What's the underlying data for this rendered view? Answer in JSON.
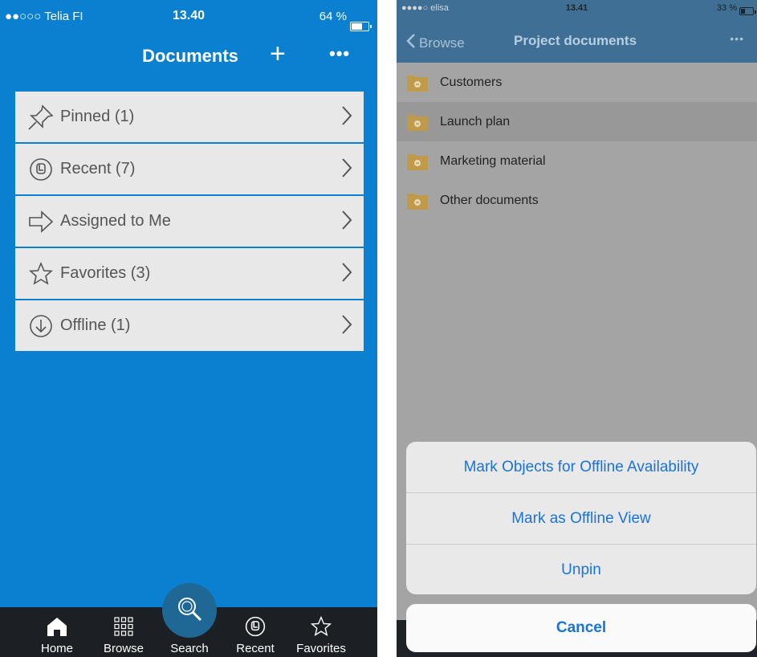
{
  "left": {
    "status": {
      "carrier": "●●○○○ Telia FI",
      "time": "13.40",
      "battery": "64 %",
      "battery_level": 0.64
    },
    "nav": {
      "title": "Documents",
      "add_label": "+",
      "more_label": "•••"
    },
    "menu": [
      {
        "label": "Pinned (1)",
        "icon": "pin-icon"
      },
      {
        "label": "Recent (7)",
        "icon": "clock-icon"
      },
      {
        "label": "Assigned to Me",
        "icon": "arrow-right-icon"
      },
      {
        "label": "Favorites (3)",
        "icon": "star-icon"
      },
      {
        "label": "Offline (1)",
        "icon": "download-icon"
      }
    ],
    "tabs": [
      {
        "label": "Home",
        "icon": "home-icon"
      },
      {
        "label": "Browse",
        "icon": "grid-icon"
      },
      {
        "label": "Search",
        "icon": "search-icon"
      },
      {
        "label": "Recent",
        "icon": "clock-icon"
      },
      {
        "label": "Favorites",
        "icon": "star-icon"
      }
    ]
  },
  "right": {
    "status": {
      "carrier": "●●●●○ elisa",
      "time": "13.41",
      "battery": "33 %",
      "battery_level": 0.33
    },
    "nav": {
      "back_label": "Browse",
      "title": "Project documents",
      "more_label": "•••"
    },
    "folders": [
      {
        "label": "Customers"
      },
      {
        "label": "Launch plan",
        "selected": true
      },
      {
        "label": "Marketing material"
      },
      {
        "label": "Other documents"
      }
    ],
    "actions": [
      {
        "label": "Mark Objects for Offline Availability"
      },
      {
        "label": "Mark as Offline View"
      },
      {
        "label": "Unpin"
      }
    ],
    "cancel_label": "Cancel"
  },
  "colors": {
    "primary_blue": "#0b7fd0",
    "action_blue": "#1a73d9",
    "tabbar": "#1c1f24",
    "folder": "#c09a4b"
  }
}
